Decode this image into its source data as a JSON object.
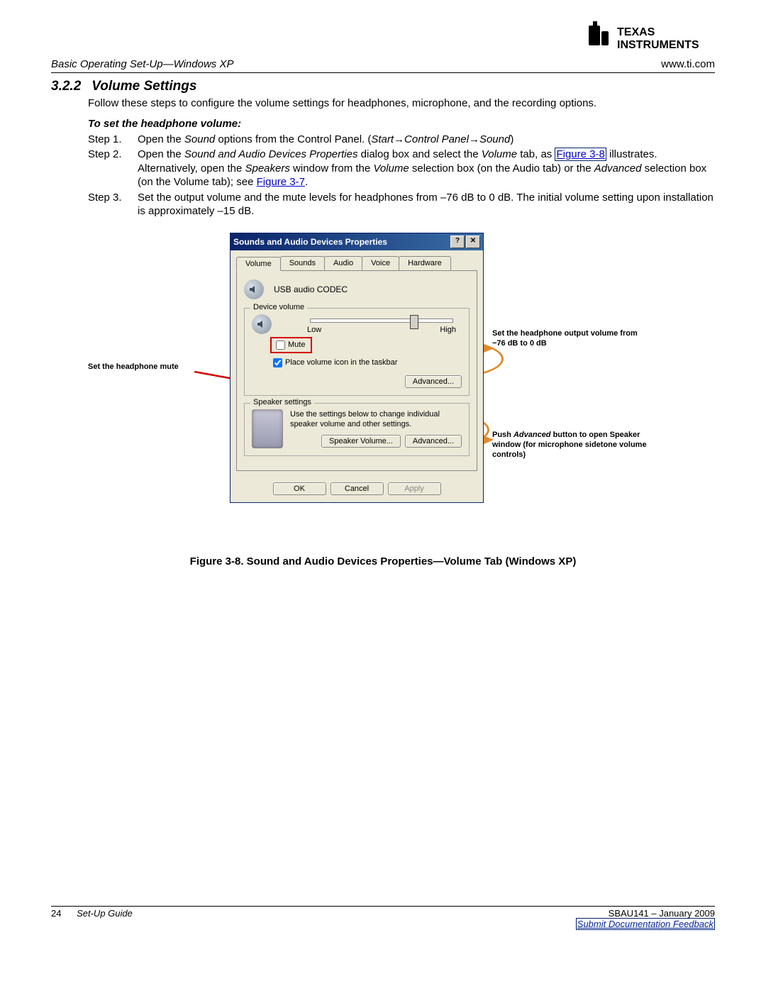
{
  "header": {
    "breadcrumb": "Basic Operating Set-Up—Windows XP",
    "url": "www.ti.com",
    "logo_name": "Texas Instruments"
  },
  "section": {
    "number": "3.2.2",
    "title": "Volume Settings",
    "intro": "Follow these steps to configure the volume settings for headphones, microphone, and the recording options.",
    "subhead": "To set the headphone volume:",
    "steps": [
      {
        "label": "Step 1.",
        "text_parts": [
          "Open the ",
          "Sound",
          " options from the Control Panel. (",
          "Start→Control Panel→Sound",
          ")"
        ]
      },
      {
        "label": "Step 2.",
        "text_parts": [
          "Open the ",
          "Sound and Audio Devices Properties",
          " dialog box and select the ",
          "Volume",
          " tab, as ",
          "Figure 3-8",
          " illustrates. Alternatively, open the ",
          "Speakers",
          " window from the ",
          "Volume",
          " selection box (on the Audio tab) or the ",
          "Advanced",
          " selection box (on the Volume tab); see ",
          "Figure 3-7",
          "."
        ]
      },
      {
        "label": "Step 3.",
        "text_parts": [
          "Set the output volume and the mute levels for headphones from –76 dB to 0 dB. The initial volume setting upon installation is approximately –15 dB."
        ]
      }
    ]
  },
  "dialog": {
    "title": "Sounds and Audio Devices Properties",
    "tabs": [
      "Volume",
      "Sounds",
      "Audio",
      "Voice",
      "Hardware"
    ],
    "active_tab": "Volume",
    "audio_name": "USB audio CODEC",
    "device_volume": {
      "legend": "Device volume",
      "low": "Low",
      "high": "High",
      "mute": "Mute",
      "taskbar": "Place volume icon in the taskbar",
      "advanced": "Advanced..."
    },
    "speaker_settings": {
      "legend": "Speaker settings",
      "desc": "Use the settings below to change individual speaker volume and other settings.",
      "btn1": "Speaker Volume...",
      "btn2": "Advanced..."
    },
    "buttons": {
      "ok": "OK",
      "cancel": "Cancel",
      "apply": "Apply"
    }
  },
  "annotations": {
    "mute": "Set the headphone mute",
    "slider": "Set the headphone output volume from −76 dB to 0 dB",
    "advanced": "Push <i>Advanced</i> button to open Speaker window (for microphone sidetone volume controls)"
  },
  "figure_caption": "Figure 3-8. Sound and Audio Devices Properties—Volume Tab (Windows XP)",
  "footer": {
    "page_num": "24",
    "doc_title": "Set-Up Guide",
    "doc_id": "SBAU141 – January 2009",
    "feedback": "Submit Documentation Feedback"
  }
}
